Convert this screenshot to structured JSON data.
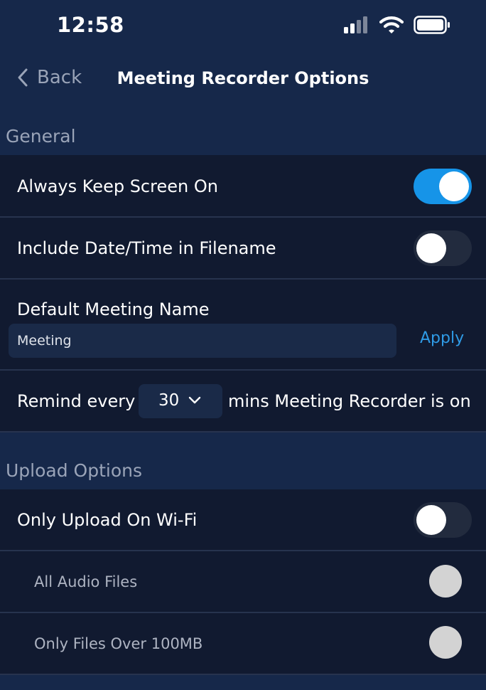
{
  "status_bar": {
    "time": "12:58"
  },
  "nav": {
    "back_label": "Back",
    "title": "Meeting Recorder Options"
  },
  "sections": {
    "general": "General",
    "upload": "Upload Options"
  },
  "general": {
    "keep_screen_on": {
      "label": "Always Keep Screen On",
      "enabled": true
    },
    "date_in_filename": {
      "label": "Include Date/Time in Filename",
      "enabled": false
    },
    "default_name": {
      "label": "Default Meeting Name",
      "value": "Meeting",
      "apply_label": "Apply"
    },
    "reminder": {
      "prefix": "Remind every",
      "value": "30",
      "suffix": "mins Meeting Recorder is on"
    }
  },
  "upload": {
    "wifi_only": {
      "label": "Only Upload On Wi-Fi",
      "enabled": false
    },
    "all_audio": {
      "label": "All Audio Files"
    },
    "over_100mb": {
      "label": "Only Files Over 100MB"
    }
  },
  "colors": {
    "background": "#16284a",
    "row": "#111a30",
    "accent": "#1694e8",
    "link": "#2f9be6"
  }
}
